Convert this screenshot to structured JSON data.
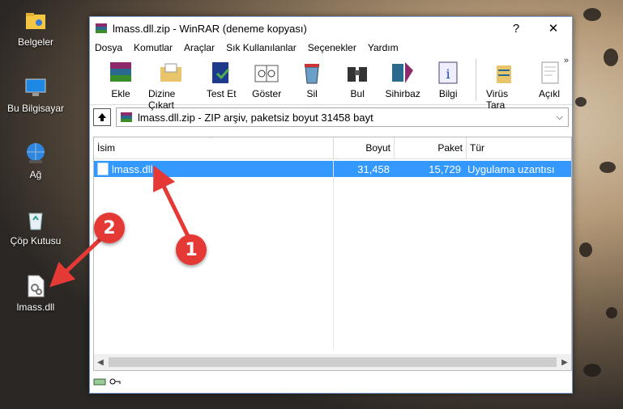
{
  "desktop": {
    "icons": [
      {
        "label": "Belgeler"
      },
      {
        "label": "Bu Bilgisayar"
      },
      {
        "label": "Ağ"
      },
      {
        "label": "Çöp Kutusu"
      },
      {
        "label": "lmass.dll"
      }
    ]
  },
  "window": {
    "title": "lmass.dll.zip - WinRAR (deneme kopyası)",
    "help_label": "?",
    "close_label": "✕",
    "menu": [
      "Dosya",
      "Komutlar",
      "Araçlar",
      "Sık Kullanılanlar",
      "Seçenekler",
      "Yardım"
    ],
    "toolbar": [
      "Ekle",
      "Dizine Çıkart",
      "Test Et",
      "Göster",
      "Sil",
      "Bul",
      "Sihirbaz",
      "Bilgi",
      "Virüs Tara",
      "Açıkl"
    ],
    "more_label": "»",
    "address": "lmass.dll.zip - ZIP arşiv, paketsiz boyut 31458 bayt",
    "columns": {
      "name": "İsim",
      "size": "Boyut",
      "packed": "Paket",
      "type": "Tür"
    },
    "files": [
      {
        "name": "lmass.dll",
        "size": "31,458",
        "packed": "15,729",
        "type": "Uygulama uzantısı"
      }
    ]
  },
  "annotations": {
    "badge1": "1",
    "badge2": "2",
    "color": "#e53935"
  }
}
